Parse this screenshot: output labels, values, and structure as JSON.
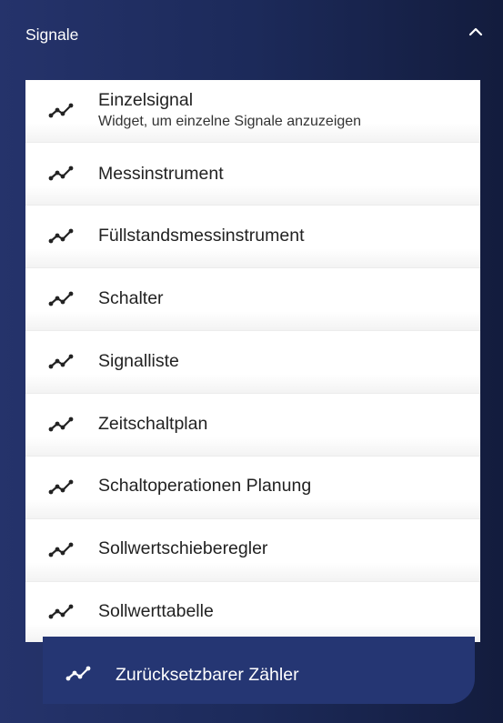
{
  "header": {
    "title": "Signale",
    "toggle_icon": "chevron-up-icon"
  },
  "items": [
    {
      "label": "Einzelsignal",
      "description": "Widget, um einzelne Signale anzuzeigen",
      "icon": "signal-line-icon"
    },
    {
      "label": "Messinstrument",
      "icon": "signal-line-icon"
    },
    {
      "label": "Füllstandsmessinstrument",
      "icon": "signal-line-icon"
    },
    {
      "label": "Schalter",
      "icon": "signal-line-icon"
    },
    {
      "label": "Signalliste",
      "icon": "signal-line-icon"
    },
    {
      "label": "Zeitschaltplan",
      "icon": "signal-line-icon"
    },
    {
      "label": "Schaltoperationen Planung",
      "icon": "signal-line-icon"
    },
    {
      "label": "Sollwertschieberegler",
      "icon": "signal-line-icon"
    },
    {
      "label": "Sollwerttabelle",
      "icon": "signal-line-icon"
    }
  ],
  "bottom_item": {
    "label": "Zurücksetzbarer Zähler",
    "icon": "signal-line-icon"
  },
  "colors": {
    "background": "#1c2a5a",
    "panel": "#ffffff",
    "bottom_item": "#253673",
    "text_dark": "#222222",
    "text_light": "#ffffff"
  }
}
